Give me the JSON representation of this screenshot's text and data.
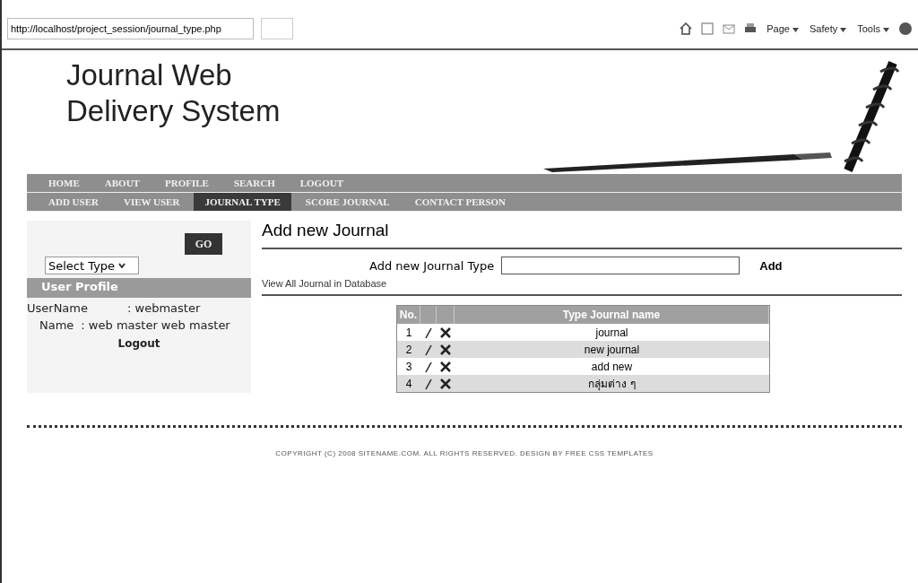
{
  "browser": {
    "address": "http://localhost/project_session/journal_type.php",
    "commands": [
      "Page",
      "Safety",
      "Tools"
    ]
  },
  "site": {
    "title": "Journal Web Delivery System"
  },
  "nav_main": [
    {
      "label": "HOME",
      "selected": false
    },
    {
      "label": "ABOUT",
      "selected": false
    },
    {
      "label": "PROFILE",
      "selected": false
    },
    {
      "label": "SEARCH",
      "selected": false
    },
    {
      "label": "LOGOUT",
      "selected": false
    }
  ],
  "nav_sub": [
    {
      "label": "ADD USER",
      "selected": false
    },
    {
      "label": "VIEW USER",
      "selected": false
    },
    {
      "label": "JOURNAL TYPE",
      "selected": true
    },
    {
      "label": "SCORE JOURNAL",
      "selected": false
    },
    {
      "label": "CONTACT PERSON",
      "selected": false
    }
  ],
  "sidebar": {
    "go_button": "GO",
    "select": "Select Type",
    "profile_title": "User Profile",
    "username_label": "UserName",
    "username": ": webmaster",
    "name_label": "Name",
    "name": ": web master web master",
    "logout": "Logout"
  },
  "content": {
    "heading": "Add new Journal",
    "field_label": "Add new Journal Type",
    "add_button": "Add",
    "view_all": "View All Journal in Database"
  },
  "table": {
    "columns": [
      "No.",
      "Type Journal name"
    ],
    "rows": [
      {
        "no": "1",
        "name": "journal"
      },
      {
        "no": "2",
        "name": "new journal"
      },
      {
        "no": "3",
        "name": "add new"
      },
      {
        "no": "4",
        "name": "กลุ่มต่าง ๆ"
      }
    ]
  },
  "footer": "COPYRIGHT (C) 2008 SITENAME.COM. ALL RIGHTS RESERVED. DESIGN BY FREE CSS TEMPLATES"
}
